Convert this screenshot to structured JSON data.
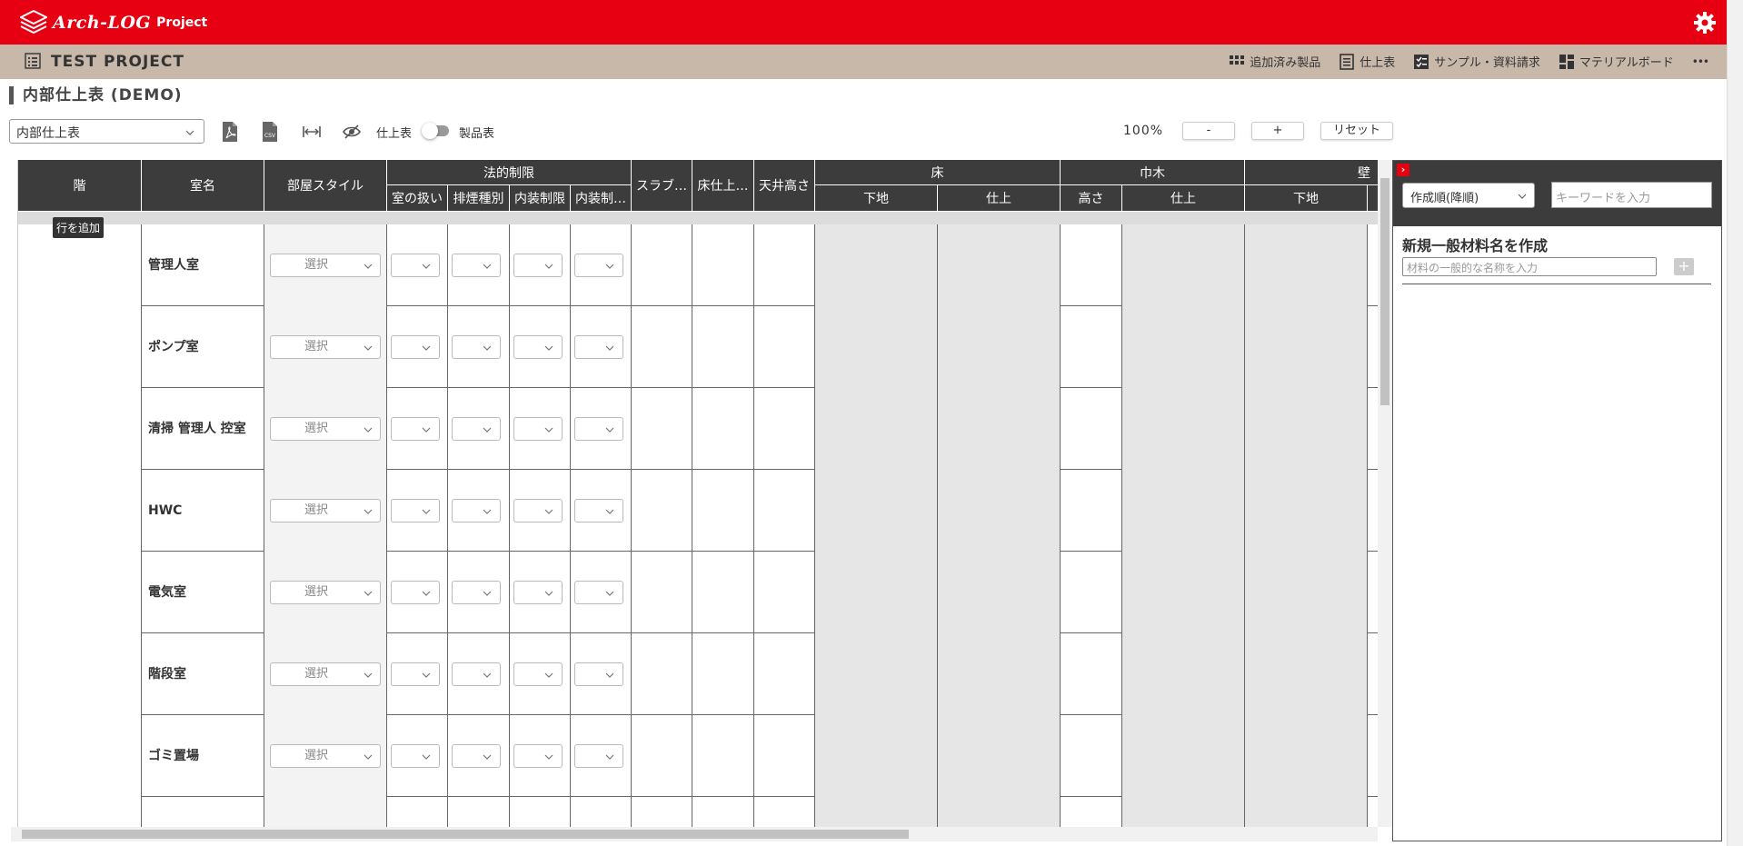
{
  "app": {
    "logo_text": "Arch-LOG",
    "logo_sub": "Project"
  },
  "project": {
    "title": "TEST PROJECT",
    "menu": [
      {
        "label": "追加済み製品",
        "icon": "grid-icon"
      },
      {
        "label": "仕上表",
        "icon": "document-icon"
      },
      {
        "label": "サンプル・資料請求",
        "icon": "checklist-icon"
      },
      {
        "label": "マテリアルボード",
        "icon": "board-icon"
      }
    ],
    "more": "•••"
  },
  "page": {
    "title": "内部仕上表 (DEMO)"
  },
  "toolbar": {
    "sheet_select": "内部仕上表",
    "toggle_left": "仕上表",
    "toggle_right": "製品表",
    "zoom": "100%",
    "zoom_minus": "-",
    "zoom_plus": "+",
    "reset": "リセット"
  },
  "table": {
    "headers": {
      "floor": "階",
      "room": "室名",
      "style": "部屋スタイル",
      "legal": "法的制限",
      "legal_sub": [
        "室の扱い",
        "排煙種別",
        "内装制限",
        "内装制…"
      ],
      "slab": "スラブ…",
      "floor_finish_h": "床仕上…",
      "ceiling_h": "天井高さ",
      "floor_group": "床",
      "floor_sub": [
        "下地",
        "仕上"
      ],
      "baseboard": "巾木",
      "baseboard_sub": [
        "高さ",
        "仕上"
      ],
      "wall": "壁",
      "wall_sub": [
        "下地"
      ]
    },
    "add_row": "行を追加",
    "select_placeholder": "選択",
    "rooms": [
      "管理人室",
      "ポンプ室",
      "清掃 管理人 控室",
      "HWC",
      "電気室",
      "階段室",
      "ゴミ置場"
    ]
  },
  "panel": {
    "close": "›",
    "sort": "作成順(降順)",
    "keyword_placeholder": "キーワードを入力",
    "new_material_title": "新規一般材料名を作成",
    "new_material_placeholder": "材料の一般的な名称を入力",
    "add": "+"
  }
}
